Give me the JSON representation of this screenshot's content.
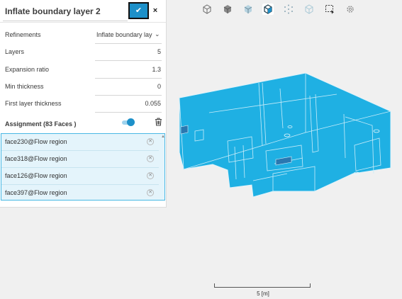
{
  "panel": {
    "title": "Inflate boundary layer 2",
    "confirm_icon": "checkmark-icon",
    "close_label": "×",
    "refinements": {
      "label": "Refinements",
      "value": "Inflate boundary layer"
    },
    "layers": {
      "label": "Layers",
      "value": "5"
    },
    "expansion_ratio": {
      "label": "Expansion ratio",
      "value": "1.3"
    },
    "min_thickness": {
      "label": "Min thickness",
      "value": "0"
    },
    "first_layer_thickness": {
      "label": "First layer thickness",
      "value": "0.055"
    },
    "assignment": {
      "label": "Assignment (83 Faces )",
      "toggle_on": true,
      "items": [
        {
          "label": "face230@Flow region"
        },
        {
          "label": "face318@Flow region"
        },
        {
          "label": "face126@Flow region"
        },
        {
          "label": "face397@Flow region"
        }
      ]
    }
  },
  "toolbar": {
    "icons": [
      "view-cube-outline-icon",
      "view-cube-solid-icon",
      "view-cube-shaded-icon",
      "view-cube-selected-icon",
      "view-cube-points-icon",
      "view-cube-transparent-icon",
      "box-select-icon",
      "settings-gear-icon"
    ],
    "active_index": 3
  },
  "scale_bar": {
    "label": "5 [m]"
  },
  "colors": {
    "accent": "#1d90c9",
    "model_fill": "#1fb0e3",
    "list_background": "#e4f4fb",
    "list_border": "#49b8e4"
  }
}
